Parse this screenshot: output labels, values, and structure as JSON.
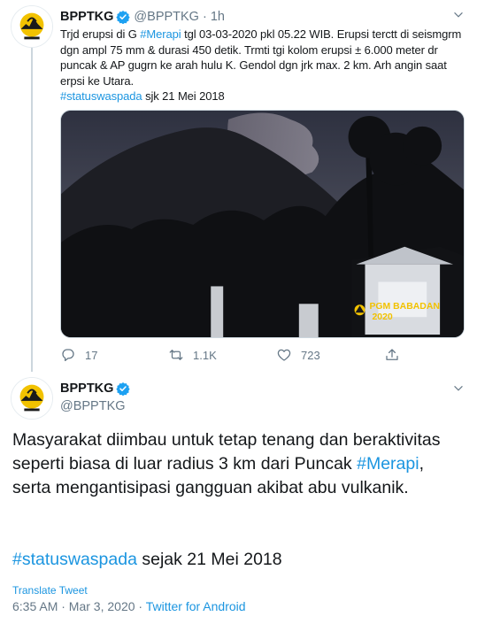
{
  "tweet1": {
    "name": "BPPTKG",
    "handle": "@BPPTKG",
    "separator": "·",
    "time": "1h",
    "text_before": "Trjd erupsi di G ",
    "hashtag_merapi": "#Merapi",
    "text_after": " tgl 03-03-2020 pkl 05.22 WIB. Erupsi terctt di seismgrm dgn ampl 75 mm & durasi 450 detik. Trmti tgi kolom erupsi ± 6.000 meter dr puncak & AP gugrn ke arah hulu K. Gendol dgn jrk max. 2 km.  Arh angin saat erpsi ke Utara.",
    "hashtag_status": "#statuswaspada",
    "text_tail": " sjk 21 Mei 2018",
    "media": {
      "watermark_line1": "PGM BABADAN",
      "watermark_line2": "2020"
    },
    "actions": {
      "reply_count": "17",
      "retweet_count": "1.1K",
      "like_count": "723"
    }
  },
  "tweet2": {
    "name": "BPPTKG",
    "handle": "@BPPTKG",
    "text_before": "Masyarakat diimbau untuk tetap tenang dan beraktivitas seperti biasa di luar radius 3 km dari Puncak ",
    "hashtag_merapi": "#Merapi",
    "text_after": ", serta mengantisipasi gangguan akibat abu vulkanik.",
    "hashtag_status": "#statuswaspada",
    "text_tail": " sejak 21 Mei 2018",
    "translate": "Translate Tweet",
    "timestamp": "6:35 AM · Mar 3, 2020 · ",
    "source": "Twitter for Android"
  },
  "colors": {
    "link": "#1b95e0",
    "muted": "#657786",
    "text": "#14171a",
    "verified": "#1da1f2"
  },
  "icons": [
    "bpptkg-logo-avatar",
    "verified-badge-icon",
    "chevron-down-icon",
    "reply-icon",
    "retweet-icon",
    "like-icon",
    "share-icon",
    "pgm-babadan-logo"
  ]
}
